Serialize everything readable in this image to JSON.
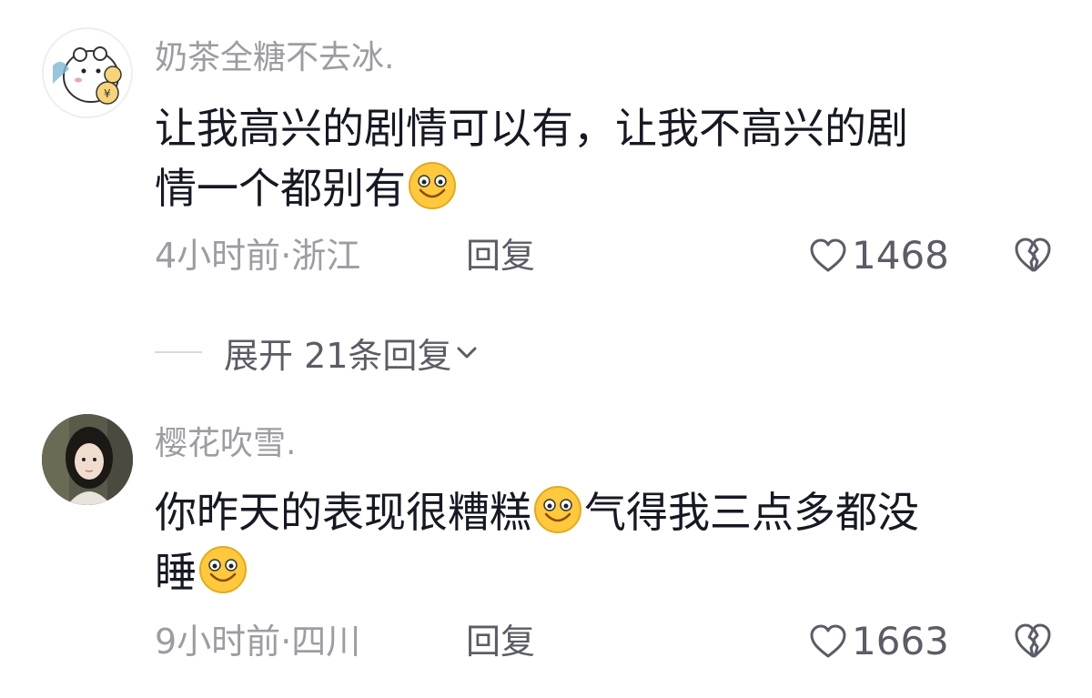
{
  "comments": [
    {
      "username": "奶茶全糖不去冰.",
      "text_line1": "让我高兴的剧情可以有，让我不高兴的剧",
      "text_line2": "情一个都别有",
      "time": "4小时前",
      "location": "浙江",
      "meta_sep": "·",
      "reply_label": "回复",
      "likes": "1468"
    },
    {
      "username": "樱花吹雪.",
      "text_line1a": "你昨天的表现很糟糕",
      "text_line1b": "气得我三点多都没",
      "text_line2": "睡",
      "time": "9小时前",
      "location": "四川",
      "meta_sep": "·",
      "reply_label": "回复",
      "likes": "1663"
    }
  ],
  "expand_replies": {
    "label": "展开 21条回复"
  },
  "icons": {
    "like": "heart-outline-icon",
    "dislike": "broken-heart-icon",
    "emoji": "smile-emoji-icon",
    "expand": "chevron-down-icon"
  },
  "colors": {
    "text_primary": "#161823",
    "text_secondary": "#9c9ca3",
    "text_action": "#5b5c66",
    "emoji_face": "#ffc83d"
  }
}
